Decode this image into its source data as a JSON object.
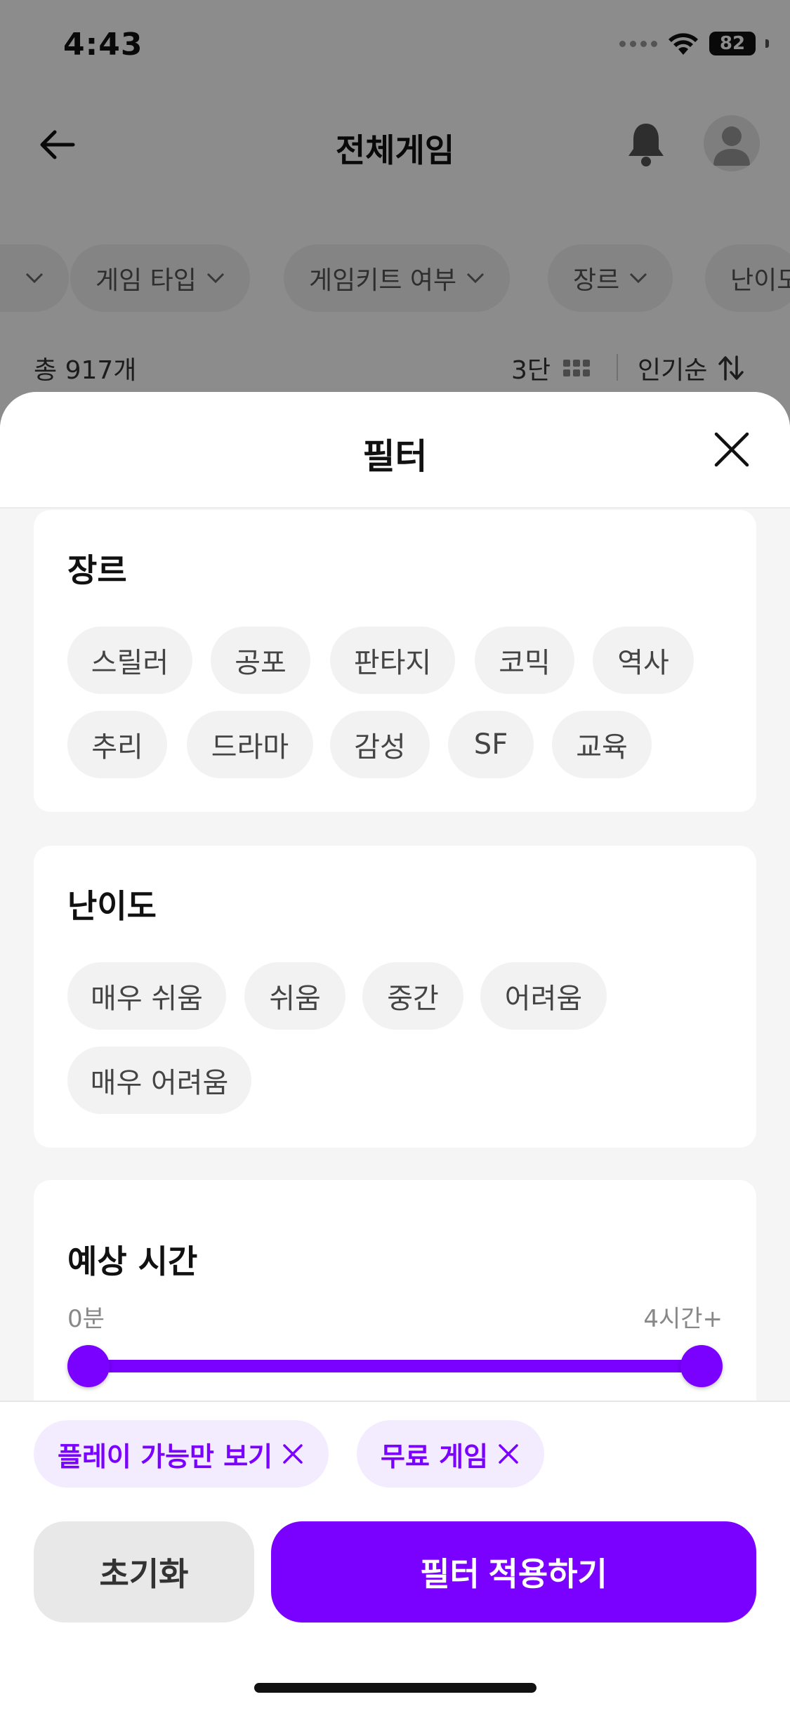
{
  "status_bar": {
    "time": "4:43",
    "battery": "82"
  },
  "header": {
    "title": "전체게임"
  },
  "filters_bar": {
    "chips": [
      "게임 타입",
      "게임키트 여부",
      "장르",
      "난이도"
    ]
  },
  "results": {
    "total": "총 917개",
    "grid_label": "3단",
    "sort_label": "인기순"
  },
  "sheet": {
    "title": "필터",
    "genre": {
      "title": "장르",
      "tags": [
        "스릴러",
        "공포",
        "판타지",
        "코믹",
        "역사",
        "추리",
        "드라마",
        "감성",
        "SF",
        "교육"
      ]
    },
    "difficulty": {
      "title": "난이도",
      "tags": [
        "매우 쉬움",
        "쉬움",
        "중간",
        "어려움",
        "매우 어려움"
      ]
    },
    "time": {
      "title": "예상 시간",
      "min_label": "0분",
      "max_label": "4시간+",
      "range": [
        0,
        1
      ]
    },
    "active_filters": [
      "플레이 가능만 보기",
      "무료 게임"
    ],
    "reset_label": "초기화",
    "apply_label": "필터 적용하기"
  },
  "colors": {
    "accent": "#7a00ff",
    "accent_soft": "#f3ecff"
  },
  "icons": [
    "back-arrow-icon",
    "bell-icon",
    "avatar-icon",
    "chevron-down-icon",
    "grid-icon",
    "sort-icon",
    "close-icon"
  ]
}
